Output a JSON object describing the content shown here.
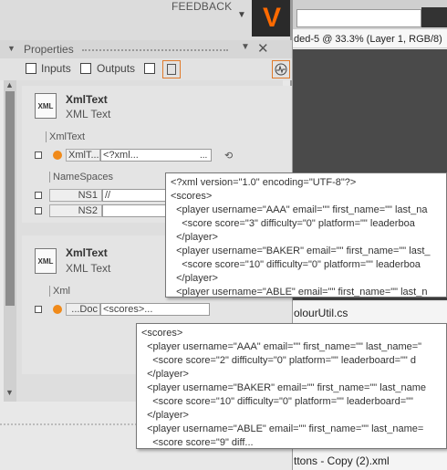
{
  "top": {
    "feedback": "FEEDBACK",
    "logo_letter": "V",
    "dropdown_glyph": "▼"
  },
  "right_pane": {
    "tab_title": "ded-5 @ 33.3% (Layer 1, RGB/8)",
    "file1": "olourUtil.cs",
    "file2": "ttons - Copy (2).xml"
  },
  "properties": {
    "title": "Properties",
    "collapse_glyph": "▼",
    "pin_glyph": "▼",
    "close_glyph": "✕",
    "toolbar": {
      "inputs_label": "Inputs",
      "outputs_label": "Outputs"
    }
  },
  "nodes": [
    {
      "icon_text": "XML",
      "title": "XmlText",
      "subtitle": "XML Text",
      "section": "XmlText",
      "port_label": "XmlT...",
      "port_value": "<?xml...",
      "dots": "...",
      "namespaces_label": "NameSpaces",
      "ns": [
        {
          "label": "NS1",
          "value": "//"
        },
        {
          "label": "NS2",
          "value": ""
        }
      ]
    },
    {
      "icon_text": "XML",
      "title": "XmlText",
      "subtitle": "XML Text",
      "section": "Xml",
      "port_label": "...Doc",
      "port_value": "<scores>..."
    }
  ],
  "tooltip1": [
    "<?xml version=\"1.0\" encoding=\"UTF-8\"?>",
    "<scores>",
    "  <player username=\"AAA\" email=\"\" first_name=\"\" last_na",
    "    <score score=\"3\" difficulty=\"0\" platform=\"\" leaderboa",
    "  </player>",
    "  <player username=\"BAKER\" email=\"\" first_name=\"\" last_",
    "    <score score=\"10\" difficulty=\"0\" platform=\"\" leaderboa",
    "  </player>",
    "  <player username=\"ABLE\" email=\"\" first_name=\"\" last_n"
  ],
  "tooltip2": [
    "<scores>",
    "  <player username=\"AAA\" email=\"\" first_name=\"\" last_name=\"",
    "    <score score=\"2\" difficulty=\"0\" platform=\"\" leaderboard=\"\" d",
    "  </player>",
    "  <player username=\"BAKER\" email=\"\" first_name=\"\" last_name",
    "    <score score=\"10\" difficulty=\"0\" platform=\"\" leaderboard=\"\"",
    "  </player>",
    "  <player username=\"ABLE\" email=\"\" first_name=\"\" last_name=",
    "    <score score=\"9\" diff..."
  ],
  "colors": {
    "accent": "#f08a1a",
    "logo_bg": "#2a2a2a"
  }
}
